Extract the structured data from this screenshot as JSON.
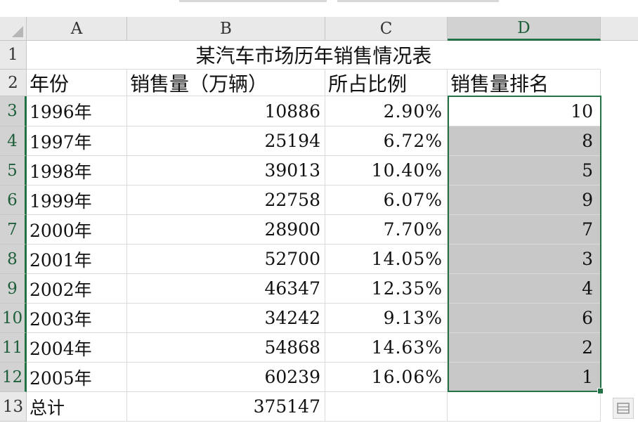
{
  "columns": [
    "A",
    "B",
    "C",
    "D"
  ],
  "selected_column": "D",
  "row_numbers": [
    "1",
    "2",
    "3",
    "4",
    "5",
    "6",
    "7",
    "8",
    "9",
    "10",
    "11",
    "12",
    "13"
  ],
  "title": "某汽车市场历年销售情况表",
  "headers": {
    "year": "年份",
    "sales": "销售量（万辆）",
    "share": "所占比例",
    "rank": "销售量排名"
  },
  "rows": [
    {
      "year": "1996年",
      "sales": "10886",
      "share": "2.90%",
      "rank": "10"
    },
    {
      "year": "1997年",
      "sales": "25194",
      "share": "6.72%",
      "rank": "8"
    },
    {
      "year": "1998年",
      "sales": "39013",
      "share": "10.40%",
      "rank": "5"
    },
    {
      "year": "1999年",
      "sales": "22758",
      "share": "6.07%",
      "rank": "9"
    },
    {
      "year": "2000年",
      "sales": "28900",
      "share": "7.70%",
      "rank": "7"
    },
    {
      "year": "2001年",
      "sales": "52700",
      "share": "14.05%",
      "rank": "3"
    },
    {
      "year": "2002年",
      "sales": "46347",
      "share": "12.35%",
      "rank": "4"
    },
    {
      "year": "2003年",
      "sales": "34242",
      "share": "9.13%",
      "rank": "6"
    },
    {
      "year": "2004年",
      "sales": "54868",
      "share": "14.63%",
      "rank": "2"
    },
    {
      "year": "2005年",
      "sales": "60239",
      "share": "16.06%",
      "rank": "1"
    }
  ],
  "total": {
    "label": "总计",
    "sales": "375147"
  },
  "selection": {
    "range": "D3:D12",
    "active_cell": "D3"
  },
  "colors": {
    "selection_border": "#217346",
    "highlight_fill": "#c8c8c8",
    "header_fill": "#e9e9e9"
  },
  "icons": {
    "quick_analysis": "quick-analysis-icon",
    "select_all": "select-all-triangle-icon"
  }
}
